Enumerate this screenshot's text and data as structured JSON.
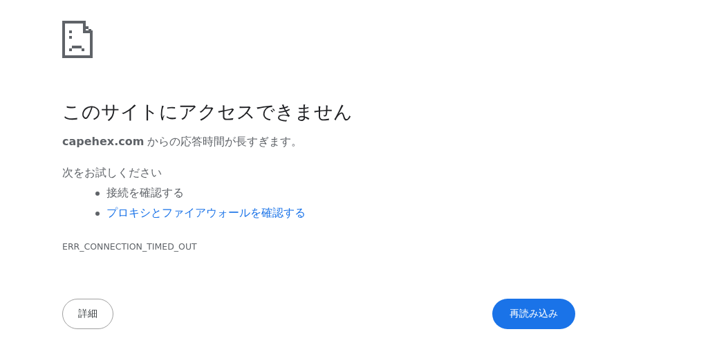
{
  "heading": "このサイトにアクセスできません",
  "description": "**capehex.com** からの応答時間が長すぎます。",
  "suggestions_title": "次をお試しください",
  "suggestions": [
    {
      "kind": "text",
      "label": "接続を確認する"
    },
    {
      "kind": "link",
      "label": "プロキシとファイアウォールを確認する"
    }
  ],
  "error_code": "ERR_CONNECTION_TIMED_OUT",
  "buttons": [
    {
      "kind": "secondary",
      "label": "詳細"
    },
    {
      "kind": "primary",
      "label": "再読み込み"
    }
  ]
}
